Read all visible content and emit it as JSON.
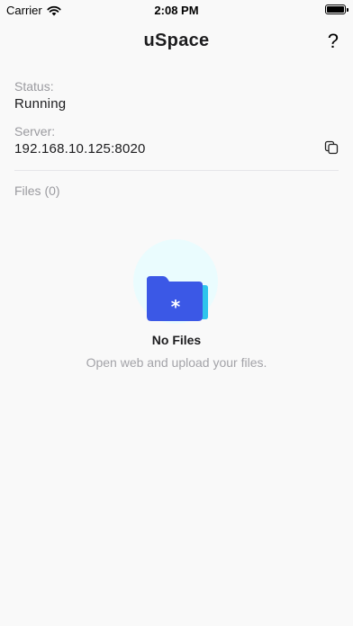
{
  "status_bar": {
    "carrier": "Carrier",
    "time": "2:08 PM"
  },
  "nav": {
    "title": "uSpace",
    "help_label": "?"
  },
  "status": {
    "label": "Status:",
    "value": "Running"
  },
  "server": {
    "label": "Server:",
    "value": "192.168.10.125:8020"
  },
  "files": {
    "header": "Files (0)"
  },
  "empty_state": {
    "title": "No Files",
    "subtitle": "Open web and upload your files.",
    "folder_glyph": "*"
  },
  "colors": {
    "folder_front": "#3b58e6",
    "folder_back": "#2ec4ec",
    "illustration_bg": "#eafcfe"
  },
  "icons": {
    "wifi": "wifi-icon",
    "battery": "battery-icon",
    "copy": "copy-icon",
    "folder": "folder-icon"
  }
}
